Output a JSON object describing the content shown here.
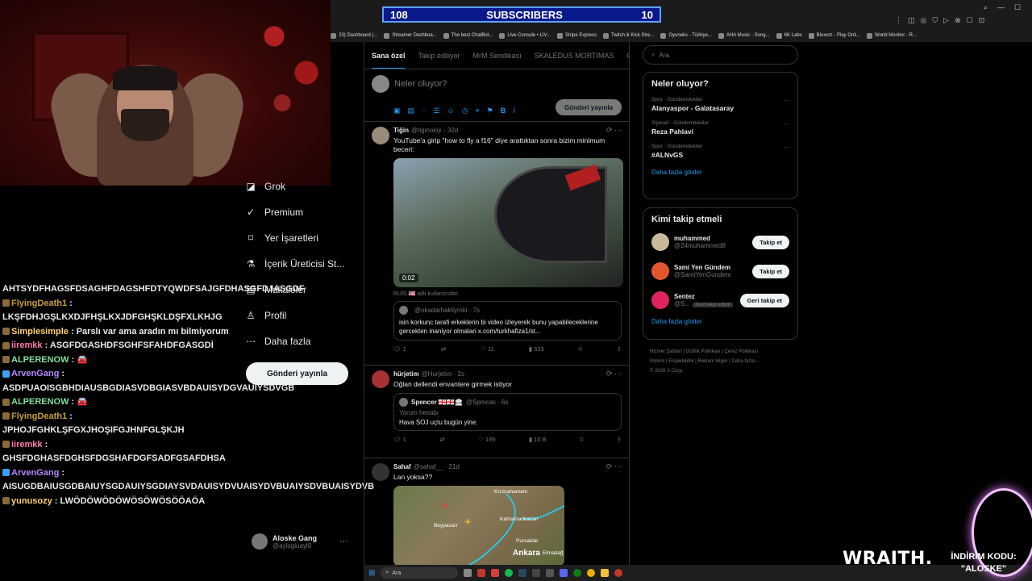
{
  "subscribers": {
    "left": "108",
    "label": "SUBSCRIBERS",
    "right": "10"
  },
  "bookmarks": [
    "23) Dashboard (...",
    "Streamer Dashboa...",
    "The best ChatBot...",
    "Live Console • LIV...",
    "Stripe Express",
    "Twitch & Kick Stre...",
    "Oyuneks - Türkiye...",
    "AHA Music - Song...",
    "6K Labs",
    "Bloxorz - Play Onli...",
    "World Monitor - R..."
  ],
  "chat": [
    {
      "user": "",
      "msg": "AHTSYDFHAGSFDSAGHFDAGSHFDTYQWDFSAJGFDHASGFDJASGDF",
      "cls": ""
    },
    {
      "user": "FlyingDeath1",
      "msg": "LKŞFDHJGŞLKXDJFHŞLKXJDFGHŞKLDŞFXLKHJG",
      "cls": "g"
    },
    {
      "user": "Simplesimple",
      "msg": "Parslı var ama aradın mı bilmiyorum",
      "cls": "y"
    },
    {
      "user": "iiremkk",
      "msg": "ASGFDGASHDFSGHFSFAHDFGASGDİ",
      "cls": "r"
    },
    {
      "user": "ALPERENOW",
      "msg": "🚘",
      "cls": ""
    },
    {
      "user": "ArvenGang",
      "msg": "ASDPUAOISGBHDIAUSBGDIASVDBGIASVBDAUISYDGVAUIYSDVGB",
      "cls": "p"
    },
    {
      "user": "ALPERENOW",
      "msg": "🚘",
      "cls": ""
    },
    {
      "user": "FlyingDeath1",
      "msg": "JPHOJFGHKLŞFGXJHOŞIFGJHNFGLŞKJH",
      "cls": "g"
    },
    {
      "user": "iiremkk",
      "msg": "GHSFDGHASFDGHSFDGSHAFDGFSADFGSAFDHSA",
      "cls": "r"
    },
    {
      "user": "ArvenGang",
      "msg": "AISUGDBAIUSGDBAIUYSGDAUIYSGDIAYSVDAUISYDVUAISYDVBUAIYSDVBUAISYDVB",
      "cls": "p"
    },
    {
      "user": "yunusozy",
      "msg": "LWÖDÖWÖDÖWÖSÖWÖSÖÖAÖA",
      "cls": "y"
    }
  ],
  "nav": [
    {
      "icon": "grok-icon",
      "glyph": "◪",
      "label": "Grok"
    },
    {
      "icon": "premium-icon",
      "glyph": "✓",
      "label": "Premium"
    },
    {
      "icon": "bookmark-icon",
      "glyph": "⌑",
      "label": "Yer İşaretleri"
    },
    {
      "icon": "creator-icon",
      "glyph": "⚗",
      "label": "İçerik Üreticisi St..."
    },
    {
      "icon": "articles-icon",
      "glyph": "▤",
      "label": "Makaleler"
    },
    {
      "icon": "profile-icon",
      "glyph": "♙",
      "label": "Profil"
    },
    {
      "icon": "more-icon",
      "glyph": "⋯",
      "label": "Daha fazla"
    }
  ],
  "post_button": "Gönderi yayınla",
  "account": {
    "name": "Aloske Gang",
    "handle": "@aylogluayl0"
  },
  "tabs": [
    "Sana özel",
    "Takip ediliyor",
    "MrM Sendikası",
    "SKALEDUS MORTIMAS",
    "Oyun"
  ],
  "compose": {
    "placeholder": "Neler oluyor?",
    "button": "Gönderi yayınla"
  },
  "tweets": [
    {
      "name": "Tiğin",
      "handle": "@tiginoloji",
      "time": "· 32d",
      "text": "YouTube'a girip \"how to fly a f16\" diye arattıktan sonra bizim minimum beceri:",
      "video_time": "0:02",
      "note": "RUIS 🇺🇸 adlı kullanıcıdan",
      "quote_name": "",
      "quote_handle": "@okadarhakliymki · 7s",
      "quote_text": "isin korkunc tarafi erkeklerin bi video izleyerek bunu yapabileceklerine gercekten inaniyor olmalari x.com/turkhafiza1/st...",
      "replies": "1",
      "retweets": "",
      "likes": "11",
      "views": "533"
    },
    {
      "name": "hürjetim",
      "handle": "@Hurjetim · 2s",
      "text": "Oğlan dellendi envantere girmek istiyor",
      "quote_name": "Ѕpencer 🇬🇪🇬🇪🏛",
      "quote_handle": "@Spmcas · 6s",
      "quote_sub": "Yorum hesabı",
      "quote_text": "Hava SOJ uçtu bugün yine.",
      "replies": "1",
      "retweets": "",
      "likes": "195",
      "views": "10 B"
    },
    {
      "name": "Sahaf",
      "handle": "@sahaf__ · 21d",
      "text": "Lan yoksa??",
      "map_labels": [
        "Kızılcahamam",
        "Kahramankazan",
        "Beypazarı",
        "Pursaklar",
        "Ankara",
        "Elmadağ"
      ]
    }
  ],
  "search_placeholder": "Ara",
  "trends_title": "Neler oluyor?",
  "trends": [
    {
      "cat": "Spor · Gündemdekiler",
      "title": "Alanyaspor - Galatasaray"
    },
    {
      "cat": "Siyaset · Gündemdekiler",
      "title": "Reza Pahlavi"
    },
    {
      "cat": "Spor · Gündemdekiler",
      "title": "#ALNvGS"
    }
  ],
  "show_more": "Daha fazla göster",
  "who_title": "Kimi takip etmeli",
  "who": [
    {
      "name": "muhammed",
      "handle": "@24muhammed8",
      "button": "Takip et",
      "color": "#c9b89a"
    },
    {
      "name": "Sami Yen Gündem",
      "handle": "@SamiYenGundem",
      "button": "Takip et",
      "color": "#e4572e"
    },
    {
      "name": "Sentez",
      "handle": "@S...",
      "tag": "Seni takip ediyor",
      "button": "Geri takip et",
      "color": "#e0245e"
    }
  ],
  "footer": [
    "Hizmet Şartları",
    "Gizlilik Politikası",
    "Çerez Politikası",
    "İmprint",
    "Erişilebilirlik",
    "Reklam bilgisi",
    "Daha fazla ···",
    "© 2026 X Corp."
  ],
  "taskbar_search": "Ara",
  "sponsor": {
    "brand": "WRAITH.",
    "line1": "İNDİRİM KODU:",
    "line2": "\"ALOSKE\""
  },
  "colors": {
    "accent": "#1d9bf0",
    "bg": "#000000",
    "border": "#2f3336",
    "subs_bg": "#0a1a8c"
  }
}
